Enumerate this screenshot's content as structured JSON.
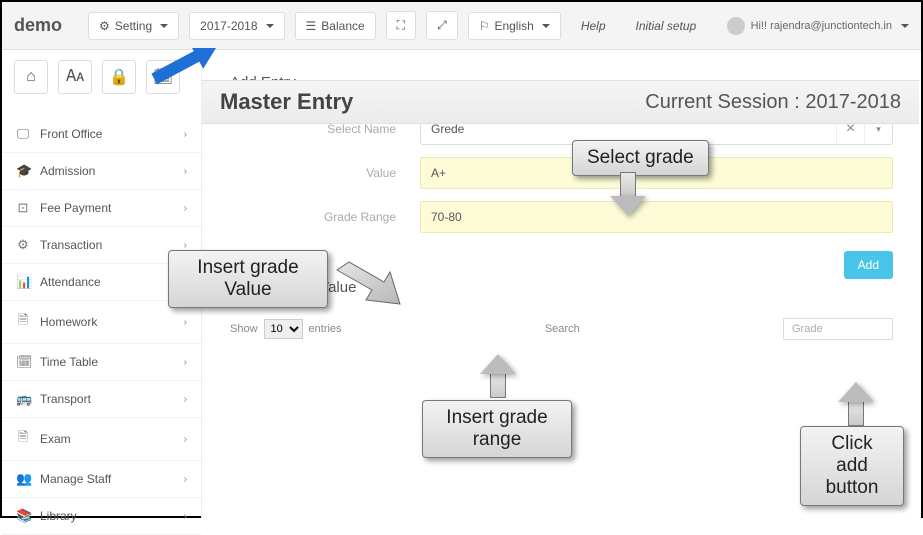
{
  "brand": "demo",
  "topbar": {
    "setting": "Setting",
    "session_year": "2017-2018",
    "balance": "Balance",
    "language": "English",
    "help": "Help",
    "initial_setup": "Initial setup",
    "user_greeting": "Hi!! rajendra@junctiontech.in"
  },
  "page": {
    "title": "Master Entry",
    "session": "Current Session : 2017-2018"
  },
  "sidebar": {
    "items": [
      {
        "icon": "🖵",
        "label": "Front Office"
      },
      {
        "icon": "🎓",
        "label": "Admission"
      },
      {
        "icon": "⊡",
        "label": "Fee Payment"
      },
      {
        "icon": "⚙",
        "label": "Transaction"
      },
      {
        "icon": "📊",
        "label": "Attendance"
      },
      {
        "icon": "🗎",
        "label": "Homework"
      },
      {
        "icon": "🗓",
        "label": "Time Table"
      },
      {
        "icon": "🚌",
        "label": "Transport"
      },
      {
        "icon": "🗎",
        "label": "Exam"
      },
      {
        "icon": "👥",
        "label": "Manage Staff"
      },
      {
        "icon": "📚",
        "label": "Library"
      }
    ]
  },
  "form": {
    "section_title": "Add Entry",
    "select_label": "Select Name",
    "select_value": "Grede",
    "value_label": "Value",
    "value_input": "A+",
    "range_label": "Grade Range",
    "range_input": "70-80",
    "add_btn": "Add"
  },
  "section2": {
    "title": "Master Entry Value",
    "show": "Show",
    "entries_count": "10",
    "entries": "entries",
    "search": "Search",
    "search_val": "Grade"
  },
  "callouts": {
    "select_grade": "Select grade",
    "insert_value_l1": "Insert grade",
    "insert_value_l2": "Value",
    "insert_range_l1": "Insert grade",
    "insert_range_l2": "range",
    "click_add_l1": "Click add",
    "click_add_l2": "button"
  }
}
